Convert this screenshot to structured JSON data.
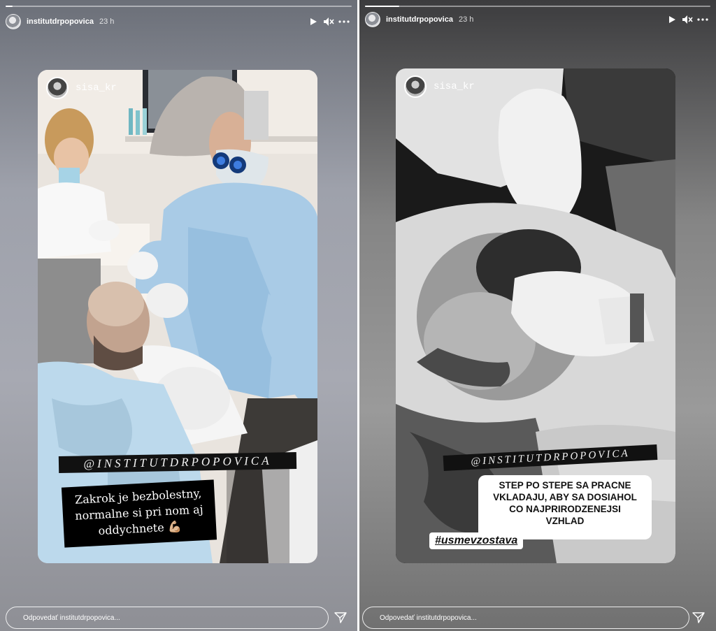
{
  "stories": [
    {
      "username": "institutdrpopovica",
      "time": "23 h",
      "progress": 0.02,
      "mention": "sisa_kr",
      "tag": "@INSTITUTDRPOPOVICA",
      "caption_lines": [
        "Zakrok je bezbolestny,",
        "normalne si pri nom aj",
        "oddychnete 💪🏼"
      ],
      "reply_placeholder": "Odpovedať institutdrpopovica...",
      "icons": [
        "avatar",
        "play-icon",
        "mute-icon",
        "more-icon",
        "send-icon"
      ]
    },
    {
      "username": "institutdrpopovica",
      "time": "23 h",
      "progress": 0.1,
      "mention": "sisa_kr",
      "tag": "@INSTITUTDRPOPOVICA",
      "caption_lines": [
        "STEP PO STEPE SA PRACNE",
        "VKLADAJU, ABY SA DOSIAHOL",
        "CO NAJPRIRODZENEJSI",
        "VZHLAD"
      ],
      "hashtag": "#usmevzostava",
      "reply_placeholder": "Odpovedať institutdrpopovica...",
      "icons": [
        "avatar",
        "play-icon",
        "mute-icon",
        "more-icon",
        "send-icon"
      ]
    }
  ],
  "colors": {
    "left_bg": "#9ea1ab",
    "right_bg": "#8a8a8a",
    "scrub_blue": "#a9cbe6"
  }
}
